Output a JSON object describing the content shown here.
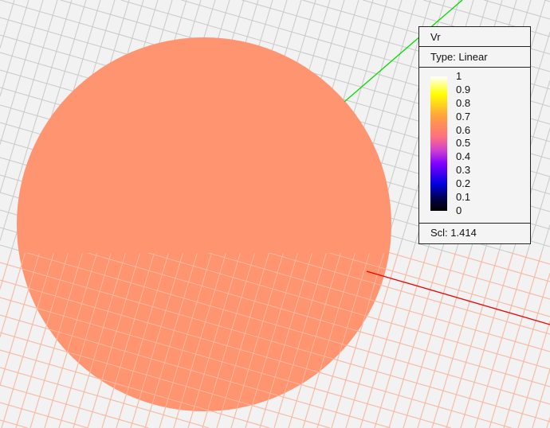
{
  "legend": {
    "title": "Vr",
    "type_label": "Type: Linear",
    "ticks": [
      "1",
      "0.9",
      "0.8",
      "0.7",
      "0.6",
      "0.5",
      "0.4",
      "0.3",
      "0.2",
      "0.1",
      "0"
    ],
    "scale_label": "Scl: 1.414"
  },
  "colors": {
    "sphere": "#ff9470",
    "x_axis": "#ff0000",
    "y_axis": "#00dd00",
    "grid": "#c8c8c8"
  }
}
